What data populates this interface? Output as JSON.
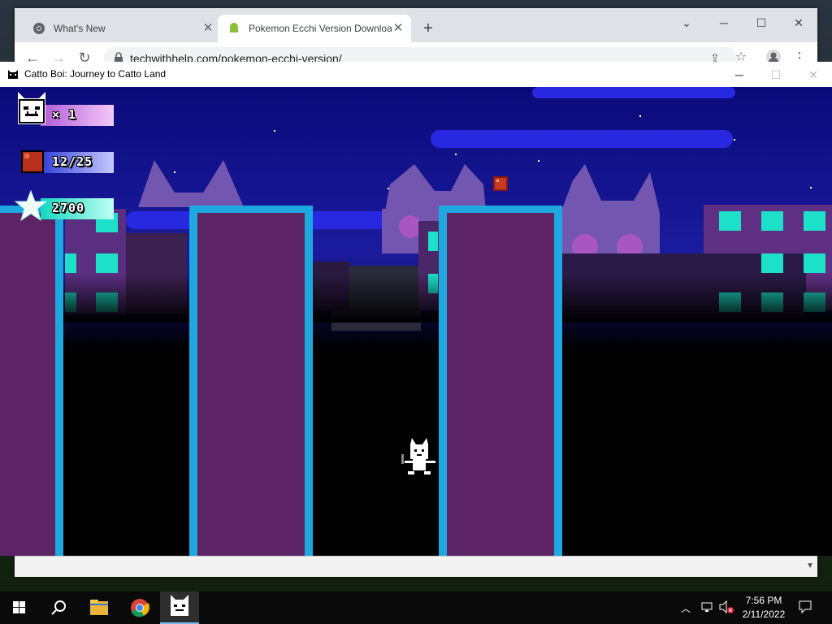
{
  "browser": {
    "tabs": [
      {
        "title": "What's New",
        "icon": "chrome-icon"
      },
      {
        "title": "Pokemon Ecchi Version Downloa",
        "icon": "android-icon"
      }
    ],
    "url": "techwithhelp.com/pokemon-ecchi-version/"
  },
  "game_window": {
    "title": "Catto Boi: Journey to Catto Land"
  },
  "hud": {
    "lives": "× 1",
    "crates": "12/25",
    "score": "2700"
  },
  "taskbar": {
    "apps": [
      "start-icon",
      "search-icon",
      "file-explorer-icon",
      "chrome-icon",
      "catto-boi-icon"
    ],
    "time": "7:56 PM",
    "date": "2/11/2022"
  },
  "colors": {
    "sky_top": "#0c0c8c",
    "sky_mid": "#1a1a9e",
    "tower": "#5c2465",
    "tower_edge": "#20a8e0",
    "cat_silhouette": "#7a5ab5",
    "window_cyan": "#1ce0c8",
    "hud_pink": "#e59cf0",
    "hud_blue": "#3c5ff0",
    "hud_teal": "#22e0c0"
  }
}
